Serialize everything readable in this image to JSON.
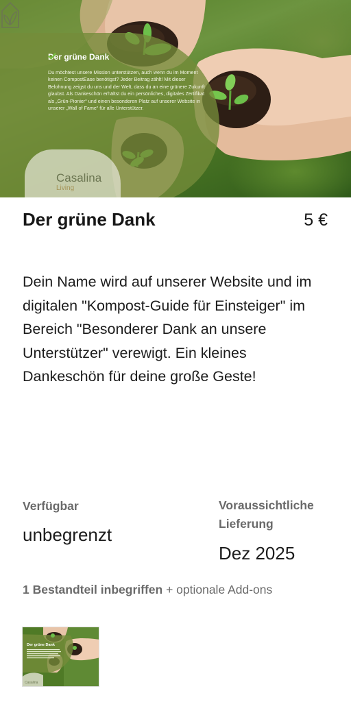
{
  "hero": {
    "title": "Der grüne Dank",
    "text": "Du möchtest unsere Mission unterstützen, auch wenn du im Moment keinen CompostEase benötigst? Jeder Beitrag zählt! Mit dieser Belohnung zeigst du uns und der Welt, dass du an eine grünere Zukunft glaubst. Als Dankeschön erhältst du ein persönliches, digitales Zertifikat als „Grün-Pionier“ und einen besonderen Platz auf unserer Website in unserer „Wall of Fame“ für alle Unterstützer.",
    "logo_line1": "Casalina",
    "logo_line2": "Living",
    "check_icon": "check-icon",
    "accent": "#7ac143"
  },
  "reward": {
    "title": "Der grüne Dank",
    "price": "5 €",
    "description": "Dein Name wird auf unserer Website und im digitalen \"Kompost-Guide für Einsteiger\" im Bereich \"Besonderer Dank an unsere Unterstützer\" verewigt. Ein kleines Dankeschön für deine große Geste!"
  },
  "availability": {
    "label": "Verfügbar",
    "value": "unbegrenzt"
  },
  "delivery": {
    "label": "Voraussichtliche Lieferung",
    "value": "Dez 2025"
  },
  "components": {
    "bold": "1 Bestandteil inbegriffen",
    "rest": " + optionale Add-ons"
  },
  "thumbnail": {
    "title": "Der grüne Dank",
    "logo": "Casalina"
  }
}
